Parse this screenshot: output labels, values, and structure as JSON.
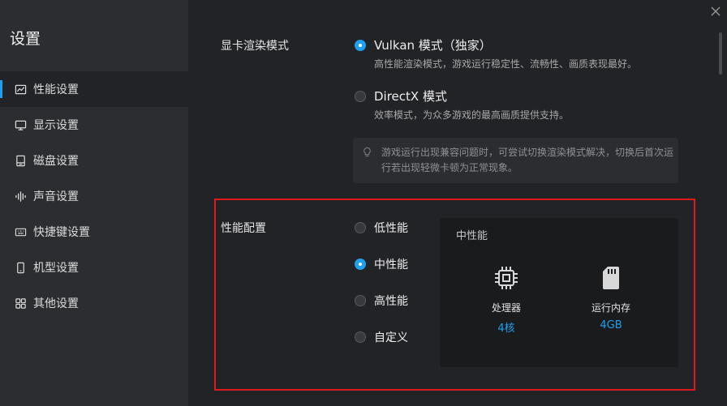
{
  "sidebar": {
    "title": "设置",
    "items": [
      {
        "label": "性能设置",
        "icon": "line-chart-icon",
        "active": true
      },
      {
        "label": "显示设置",
        "icon": "monitor-icon"
      },
      {
        "label": "磁盘设置",
        "icon": "disk-icon"
      },
      {
        "label": "声音设置",
        "icon": "sound-wave-icon"
      },
      {
        "label": "快捷键设置",
        "icon": "keyboard-icon"
      },
      {
        "label": "机型设置",
        "icon": "phone-icon"
      },
      {
        "label": "其他设置",
        "icon": "grid-icon"
      }
    ]
  },
  "render": {
    "label": "显卡渲染模式",
    "options": [
      {
        "label": "Vulkan 模式（独家）",
        "desc": "高性能渲染模式，游戏运行稳定性、流畅性、画质表现最好。",
        "checked": true
      },
      {
        "label": "DirectX 模式",
        "desc": "效率模式，为众多游戏的最高画质提供支持。",
        "checked": false
      }
    ],
    "tip": "游戏运行出现兼容问题时，可尝试切换渲染模式解决，切换后首次运行若出现轻微卡顿为正常现象。"
  },
  "performance": {
    "label": "性能配置",
    "options": [
      {
        "label": "低性能",
        "checked": false
      },
      {
        "label": "中性能",
        "checked": true
      },
      {
        "label": "高性能",
        "checked": false
      },
      {
        "label": "自定义",
        "checked": false
      }
    ],
    "panel": {
      "title": "中性能",
      "cpu": {
        "name": "处理器",
        "value": "4核",
        "icon": "cpu-chip-icon"
      },
      "memory": {
        "name": "运行内存",
        "value": "4GB",
        "icon": "memory-card-icon"
      }
    }
  },
  "colors": {
    "accent": "#1ea0ee",
    "highlight": "#e0191e"
  }
}
